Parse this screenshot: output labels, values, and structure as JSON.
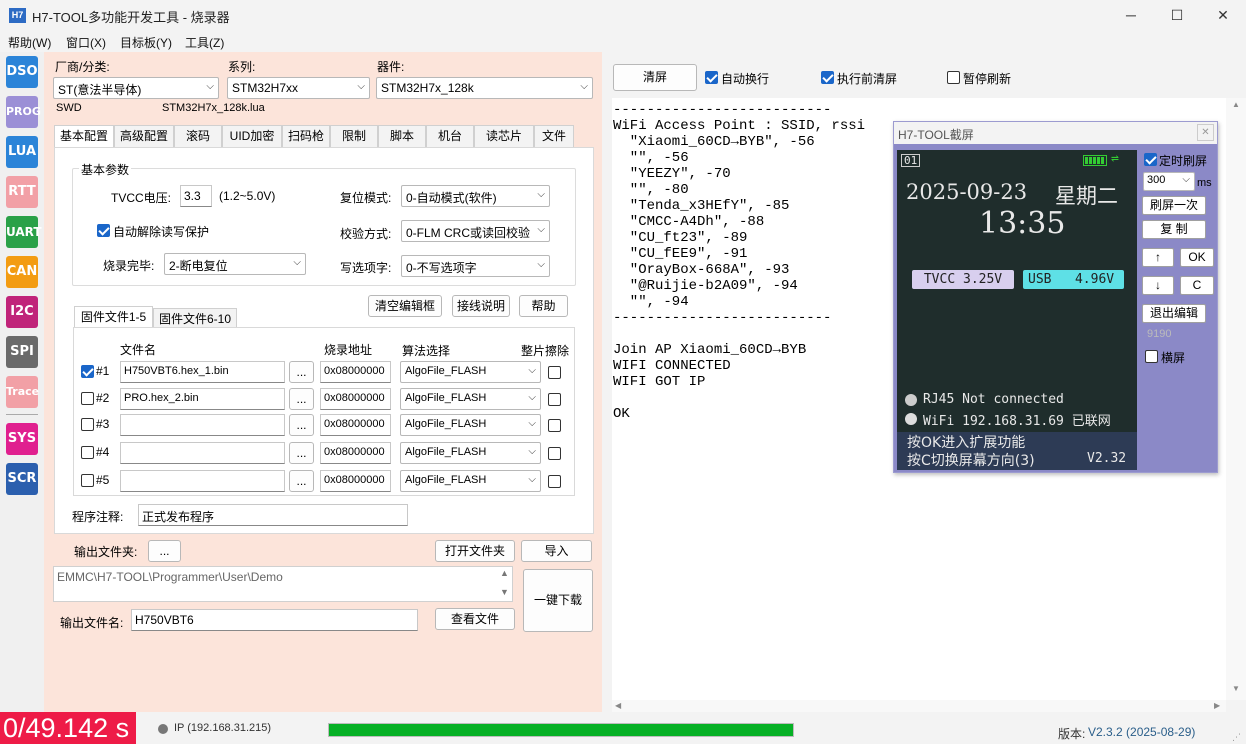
{
  "window": {
    "title": "H7-TOOL多功能开发工具 - 烧录器",
    "icon": "H7",
    "minimize": "─",
    "maximize": "☐",
    "close": "✕"
  },
  "menu": [
    "帮助(W)",
    "窗口(X)",
    "目标板(Y)",
    "工具(Z)"
  ],
  "sidebar": [
    "DSO",
    "PROG",
    "LUA",
    "RTT",
    "UART",
    "CAN",
    "I2C",
    "SPI",
    "Trace",
    "SYS",
    "SCR"
  ],
  "colors": {
    "DSO": "#2b84d8",
    "PROG": "#9b8fd6",
    "LUA": "#2b84d8",
    "RTT": "#f2a0a6",
    "UART": "#2aa148",
    "CAN": "#f39c12",
    "I2C": "#c0247a",
    "SPI": "#6a6a6a",
    "Trace": "#f2a0a6",
    "SYS": "#e0208f",
    "SCR": "#2b5fae"
  },
  "device": {
    "vendor_label": "厂商/分类:",
    "vendor": "ST(意法半导体)",
    "series_label": "系列:",
    "series": "STM32H7xx",
    "part_label": "器件:",
    "part": "STM32H7x_128k",
    "iface": "SWD",
    "lua": "STM32H7x_128k.lua"
  },
  "tabs": [
    "基本配置",
    "高级配置",
    "滚码",
    "UID加密",
    "扫码枪",
    "限制",
    "脚本",
    "机台",
    "读芯片",
    "文件"
  ],
  "basic": {
    "group": "基本参数",
    "tvcc_label": "TVCC电压:",
    "tvcc": "3.3",
    "tvcc_range": "(1.2~5.0V)",
    "reset_label": "复位模式:",
    "reset": "0-自动模式(软件)",
    "unlock": "自动解除读写保护",
    "verify_label": "校验方式:",
    "verify": "0-FLM CRC或读回校验",
    "done_label": "烧录完毕:",
    "done": "2-断电复位",
    "option_label": "写选项字:",
    "option": "0-不写选项字"
  },
  "buttons": {
    "clear_editor": "清空编辑框",
    "wiring": "接线说明",
    "help": "帮助",
    "open_folder": "打开文件夹",
    "import": "导入",
    "download": "一键下载",
    "view_file": "查看文件",
    "browse": "...",
    "clear_screen": "清屏"
  },
  "file_tabs": [
    "固件文件1-5",
    "固件文件6-10"
  ],
  "file_headers": {
    "name": "文件名",
    "addr": "烧录地址",
    "algo": "算法选择",
    "erase": "整片擦除"
  },
  "files": [
    {
      "idx": "#1",
      "checked": true,
      "name": "H750VBT6.hex_1.bin",
      "addr": "0x08000000",
      "algo": "AlgoFile_FLASH"
    },
    {
      "idx": "#2",
      "checked": false,
      "name": "PRO.hex_2.bin",
      "addr": "0x08000000",
      "algo": "AlgoFile_FLASH"
    },
    {
      "idx": "#3",
      "checked": false,
      "name": "",
      "addr": "0x08000000",
      "algo": "AlgoFile_FLASH"
    },
    {
      "idx": "#4",
      "checked": false,
      "name": "",
      "addr": "0x08000000",
      "algo": "AlgoFile_FLASH"
    },
    {
      "idx": "#5",
      "checked": false,
      "name": "",
      "addr": "0x08000000",
      "algo": "AlgoFile_FLASH"
    }
  ],
  "note_label": "程序注释:",
  "note": "正式发布程序",
  "output": {
    "folder_label": "输出文件夹:",
    "path": "EMMC\\H7-TOOL\\Programmer\\User\\Demo",
    "name_label": "输出文件名:",
    "name": "H750VBT6"
  },
  "console_opts": {
    "wrap": "自动换行",
    "clear_before": "执行前清屏",
    "pause": "暂停刷新"
  },
  "console_lines": [
    "--------------------------",
    "WiFi Access Point : SSID, rssi",
    "  \"Xiaomi_60CD→BYB\", -56",
    "  \"\", -56",
    "  \"YEEZY\", -70",
    "  \"\", -80",
    "  \"Tenda_x3HEfY\", -85",
    "  \"CMCC-A4Dh\", -88",
    "  \"CU_ft23\", -89",
    "  \"CU_fEE9\", -91",
    "  \"OrayBox-668A\", -93",
    "  \"@Ruijie-b2A09\", -94",
    "  \"\", -94",
    "--------------------------",
    "",
    "Join AP Xiaomi_60CD→BYB",
    "WIFI CONNECTED",
    "WIFI GOT IP",
    "",
    "OK"
  ],
  "capture": {
    "title": "H7-TOOL截屏",
    "close": "✕",
    "timed": "定时刷屏",
    "interval": "300",
    "unit": "ms",
    "refresh_once": "刷屏一次",
    "copy": "复 制",
    "up": "↑",
    "ok": "OK",
    "down": "↓",
    "c": "C",
    "exit_edit": "退出编辑",
    "port": "9190",
    "landscape": "横屏"
  },
  "screen": {
    "page": "01",
    "date": "2025-09-23",
    "weekday": "星期二",
    "time": "13:35",
    "tvcc": "TVCC 3.25V",
    "usb": "USB   4.96V",
    "rj45": "RJ45 Not connected",
    "wifi": "WiFi 192.168.31.69 已联网",
    "hint1": "按OK进入扩展功能",
    "hint2": "按C切换屏幕方向(3)",
    "ver": "V2.32"
  },
  "status": {
    "timer": "0/49.142 s",
    "ip": "IP (192.168.31.215)",
    "progress": 1.0,
    "version_label": "版本:",
    "version": "V2.3.2 (2025-08-29)"
  }
}
